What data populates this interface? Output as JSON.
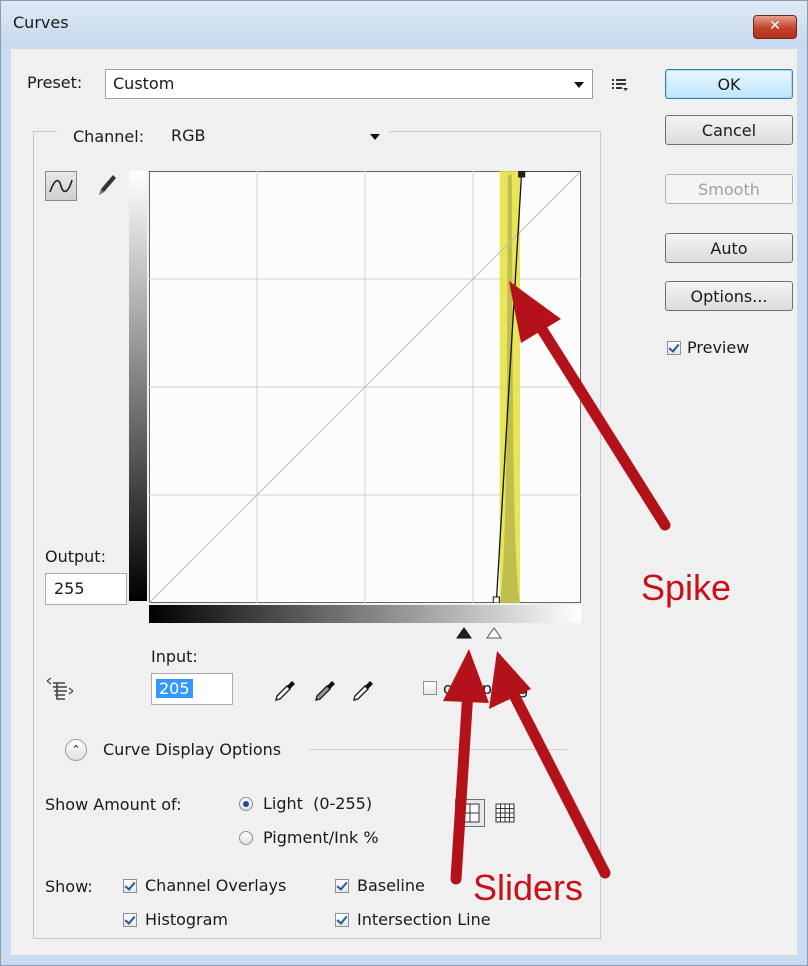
{
  "window": {
    "title": "Curves",
    "close_glyph": "✕"
  },
  "preset": {
    "label": "Preset:",
    "value": "Custom"
  },
  "buttons": {
    "ok": "OK",
    "cancel": "Cancel",
    "smooth": "Smooth",
    "auto": "Auto",
    "options": "Options..."
  },
  "preview": {
    "label": "Preview",
    "checked": true
  },
  "channel": {
    "label": "Channel:",
    "value": "RGB"
  },
  "output": {
    "label": "Output:",
    "value": "255"
  },
  "input": {
    "label": "Input:",
    "value": "205"
  },
  "show_clipping": {
    "label": "Show Clipping",
    "visible_text": "ow lipping",
    "checked": false
  },
  "curve_display": {
    "label": "Curve Display Options"
  },
  "show_amount": {
    "label": "Show Amount of:",
    "light": "Light  (0-255)",
    "pigment": "Pigment/Ink %",
    "selected": "light"
  },
  "show": {
    "label": "Show:",
    "channel_overlays": "Channel Overlays",
    "baseline": "Baseline",
    "histogram": "Histogram",
    "intersection_line": "Intersection Line"
  },
  "annotations": {
    "spike": "Spike",
    "sliders": "Sliders"
  },
  "icons": [
    "curve-tool-icon",
    "pencil-icon",
    "panel-menu-icon",
    "hand-adjust-icon",
    "black-eyedropper-icon",
    "gray-eyedropper-icon",
    "white-eyedropper-icon",
    "expand-collapse-icon",
    "grid-simple-icon",
    "grid-detailed-icon",
    "black-point-slider-icon",
    "white-point-slider-icon"
  ],
  "colors": {
    "highlight": "#e4e13c",
    "arrow": "#b3121a",
    "title_bar": "#c9dcef",
    "default_button": "#bee6fd"
  },
  "chart_data": {
    "type": "line",
    "xlim": [
      0,
      255
    ],
    "ylim": [
      0,
      255
    ],
    "grid": true,
    "curve_points": [
      [
        205,
        0
      ],
      [
        220,
        255
      ],
      [
        255,
        255
      ]
    ],
    "baseline": [
      [
        0,
        0
      ],
      [
        255,
        255
      ]
    ],
    "histogram_spike": {
      "center": 213,
      "from": 207,
      "to": 219
    }
  }
}
